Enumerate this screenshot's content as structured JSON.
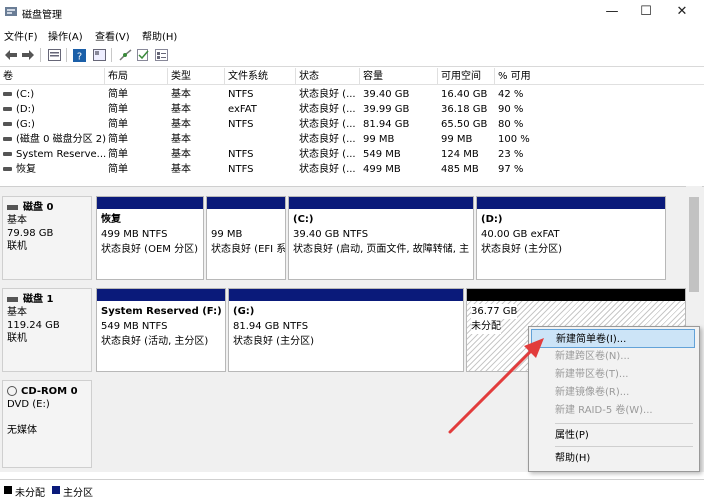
{
  "window": {
    "title": "磁盘管理",
    "min": "—",
    "max": "☐",
    "close": "✕"
  },
  "menu": [
    "文件(F)",
    "操作(A)",
    "查看(V)",
    "帮助(H)"
  ],
  "columns": [
    "卷",
    "布局",
    "类型",
    "文件系统",
    "状态",
    "容量",
    "可用空间",
    "% 可用"
  ],
  "volumes": [
    [
      "(C:)",
      "简单",
      "基本",
      "NTFS",
      "状态良好 (...",
      "39.40 GB",
      "16.40 GB",
      "42 %"
    ],
    [
      "(D:)",
      "简单",
      "基本",
      "exFAT",
      "状态良好 (...",
      "39.99 GB",
      "36.18 GB",
      "90 %"
    ],
    [
      "(G:)",
      "简单",
      "基本",
      "NTFS",
      "状态良好 (...",
      "81.94 GB",
      "65.50 GB",
      "80 %"
    ],
    [
      "(磁盘 0 磁盘分区 2)",
      "简单",
      "基本",
      "",
      "状态良好 (...",
      "99 MB",
      "99 MB",
      "100 %"
    ],
    [
      "System Reserve...",
      "简单",
      "基本",
      "NTFS",
      "状态良好 (...",
      "549 MB",
      "124 MB",
      "23 %"
    ],
    [
      "恢复",
      "简单",
      "基本",
      "NTFS",
      "状态良好 (...",
      "499 MB",
      "485 MB",
      "97 %"
    ]
  ],
  "disks": {
    "disk0": {
      "name": "磁盘 0",
      "type": "基本",
      "size": "79.98 GB",
      "status": "联机"
    },
    "disk1": {
      "name": "磁盘 1",
      "type": "基本",
      "size": "119.24 GB",
      "status": "联机"
    },
    "cdrom": {
      "name": "CD-ROM 0",
      "drive": "DVD (E:)",
      "media": "无媒体"
    }
  },
  "partitions": {
    "d0p1": {
      "l1": "恢复",
      "l2": "499 MB NTFS",
      "l3": "状态良好 (OEM 分区)"
    },
    "d0p2": {
      "l1": "",
      "l2": "99 MB",
      "l3": "状态良好 (EFI 系"
    },
    "d0p3": {
      "l1": "(C:)",
      "l2": "39.40 GB NTFS",
      "l3": "状态良好 (启动, 页面文件, 故障转储, 主"
    },
    "d0p4": {
      "l1": "(D:)",
      "l2": "40.00 GB exFAT",
      "l3": "状态良好 (主分区)"
    },
    "d1p1": {
      "l1": "System Reserved  (F:)",
      "l2": "549 MB NTFS",
      "l3": "状态良好 (活动, 主分区)"
    },
    "d1p2": {
      "l1": "(G:)",
      "l2": "81.94 GB NTFS",
      "l3": "状态良好 (主分区)"
    },
    "d1p3": {
      "l1": "36.77 GB",
      "l2": "未分配"
    }
  },
  "context_menu": {
    "new_simple": "新建简单卷(I)...",
    "new_spanned": "新建跨区卷(N)...",
    "new_striped": "新建带区卷(T)...",
    "new_mirrored": "新建镜像卷(R)...",
    "new_raid5": "新建 RAID-5 卷(W)...",
    "properties": "属性(P)",
    "help": "帮助(H)"
  },
  "legend": {
    "unallocated": "未分配",
    "primary": "主分区"
  },
  "colors": {
    "primary_bar": "#0a1a7a",
    "unallocated_bar": "#000000",
    "highlight": "#cce4f7",
    "arrow": "#e23c3c"
  }
}
